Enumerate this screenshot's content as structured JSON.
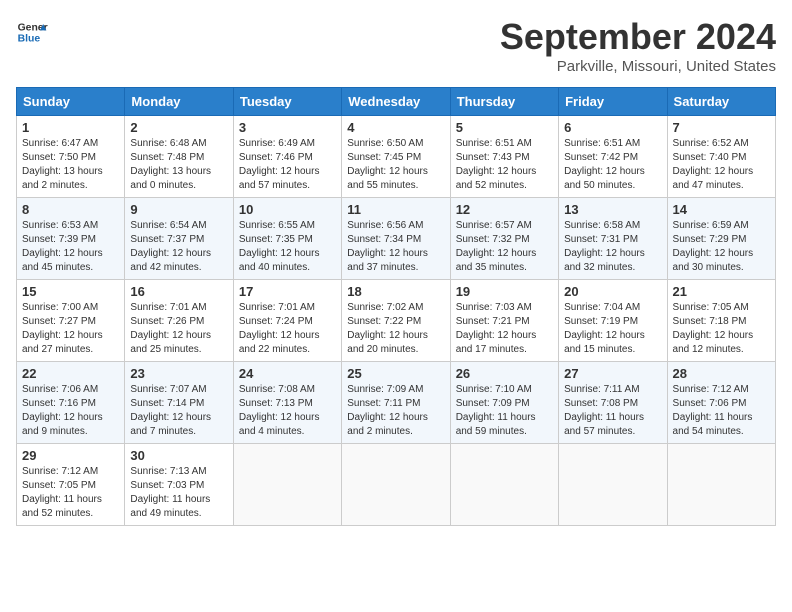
{
  "header": {
    "logo_line1": "General",
    "logo_line2": "Blue",
    "month": "September 2024",
    "location": "Parkville, Missouri, United States"
  },
  "weekdays": [
    "Sunday",
    "Monday",
    "Tuesday",
    "Wednesday",
    "Thursday",
    "Friday",
    "Saturday"
  ],
  "weeks": [
    [
      {
        "day": "1",
        "info": "Sunrise: 6:47 AM\nSunset: 7:50 PM\nDaylight: 13 hours\nand 2 minutes."
      },
      {
        "day": "2",
        "info": "Sunrise: 6:48 AM\nSunset: 7:48 PM\nDaylight: 13 hours\nand 0 minutes."
      },
      {
        "day": "3",
        "info": "Sunrise: 6:49 AM\nSunset: 7:46 PM\nDaylight: 12 hours\nand 57 minutes."
      },
      {
        "day": "4",
        "info": "Sunrise: 6:50 AM\nSunset: 7:45 PM\nDaylight: 12 hours\nand 55 minutes."
      },
      {
        "day": "5",
        "info": "Sunrise: 6:51 AM\nSunset: 7:43 PM\nDaylight: 12 hours\nand 52 minutes."
      },
      {
        "day": "6",
        "info": "Sunrise: 6:51 AM\nSunset: 7:42 PM\nDaylight: 12 hours\nand 50 minutes."
      },
      {
        "day": "7",
        "info": "Sunrise: 6:52 AM\nSunset: 7:40 PM\nDaylight: 12 hours\nand 47 minutes."
      }
    ],
    [
      {
        "day": "8",
        "info": "Sunrise: 6:53 AM\nSunset: 7:39 PM\nDaylight: 12 hours\nand 45 minutes."
      },
      {
        "day": "9",
        "info": "Sunrise: 6:54 AM\nSunset: 7:37 PM\nDaylight: 12 hours\nand 42 minutes."
      },
      {
        "day": "10",
        "info": "Sunrise: 6:55 AM\nSunset: 7:35 PM\nDaylight: 12 hours\nand 40 minutes."
      },
      {
        "day": "11",
        "info": "Sunrise: 6:56 AM\nSunset: 7:34 PM\nDaylight: 12 hours\nand 37 minutes."
      },
      {
        "day": "12",
        "info": "Sunrise: 6:57 AM\nSunset: 7:32 PM\nDaylight: 12 hours\nand 35 minutes."
      },
      {
        "day": "13",
        "info": "Sunrise: 6:58 AM\nSunset: 7:31 PM\nDaylight: 12 hours\nand 32 minutes."
      },
      {
        "day": "14",
        "info": "Sunrise: 6:59 AM\nSunset: 7:29 PM\nDaylight: 12 hours\nand 30 minutes."
      }
    ],
    [
      {
        "day": "15",
        "info": "Sunrise: 7:00 AM\nSunset: 7:27 PM\nDaylight: 12 hours\nand 27 minutes."
      },
      {
        "day": "16",
        "info": "Sunrise: 7:01 AM\nSunset: 7:26 PM\nDaylight: 12 hours\nand 25 minutes."
      },
      {
        "day": "17",
        "info": "Sunrise: 7:01 AM\nSunset: 7:24 PM\nDaylight: 12 hours\nand 22 minutes."
      },
      {
        "day": "18",
        "info": "Sunrise: 7:02 AM\nSunset: 7:22 PM\nDaylight: 12 hours\nand 20 minutes."
      },
      {
        "day": "19",
        "info": "Sunrise: 7:03 AM\nSunset: 7:21 PM\nDaylight: 12 hours\nand 17 minutes."
      },
      {
        "day": "20",
        "info": "Sunrise: 7:04 AM\nSunset: 7:19 PM\nDaylight: 12 hours\nand 15 minutes."
      },
      {
        "day": "21",
        "info": "Sunrise: 7:05 AM\nSunset: 7:18 PM\nDaylight: 12 hours\nand 12 minutes."
      }
    ],
    [
      {
        "day": "22",
        "info": "Sunrise: 7:06 AM\nSunset: 7:16 PM\nDaylight: 12 hours\nand 9 minutes."
      },
      {
        "day": "23",
        "info": "Sunrise: 7:07 AM\nSunset: 7:14 PM\nDaylight: 12 hours\nand 7 minutes."
      },
      {
        "day": "24",
        "info": "Sunrise: 7:08 AM\nSunset: 7:13 PM\nDaylight: 12 hours\nand 4 minutes."
      },
      {
        "day": "25",
        "info": "Sunrise: 7:09 AM\nSunset: 7:11 PM\nDaylight: 12 hours\nand 2 minutes."
      },
      {
        "day": "26",
        "info": "Sunrise: 7:10 AM\nSunset: 7:09 PM\nDaylight: 11 hours\nand 59 minutes."
      },
      {
        "day": "27",
        "info": "Sunrise: 7:11 AM\nSunset: 7:08 PM\nDaylight: 11 hours\nand 57 minutes."
      },
      {
        "day": "28",
        "info": "Sunrise: 7:12 AM\nSunset: 7:06 PM\nDaylight: 11 hours\nand 54 minutes."
      }
    ],
    [
      {
        "day": "29",
        "info": "Sunrise: 7:12 AM\nSunset: 7:05 PM\nDaylight: 11 hours\nand 52 minutes."
      },
      {
        "day": "30",
        "info": "Sunrise: 7:13 AM\nSunset: 7:03 PM\nDaylight: 11 hours\nand 49 minutes."
      },
      {
        "day": "",
        "info": ""
      },
      {
        "day": "",
        "info": ""
      },
      {
        "day": "",
        "info": ""
      },
      {
        "day": "",
        "info": ""
      },
      {
        "day": "",
        "info": ""
      }
    ]
  ]
}
